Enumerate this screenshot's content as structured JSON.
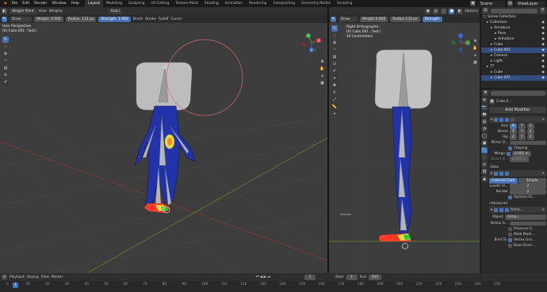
{
  "menubar": {
    "file": "File",
    "edit": "Edit",
    "render": "Render",
    "window": "Window",
    "help": "Help",
    "scene": "Scene",
    "view_layer": "ViewLayer"
  },
  "workspaces": [
    "Layout",
    "Modeling",
    "Sculpting",
    "UV Editing",
    "Texture Paint",
    "Shading",
    "Animation",
    "Rendering",
    "Compositing",
    "Geometry Nodes",
    "Scripting"
  ],
  "left_view": {
    "header": {
      "mode": "Weight Paint",
      "view": "View",
      "weights": "Weights",
      "object": "foot.l",
      "brush": "Draw",
      "weight_label": "Weight",
      "weight_value": "0.000",
      "radius_label": "Radius",
      "radius_value": "133 px",
      "strength_label": "Strength",
      "strength_value": "1.000",
      "brush_menu": "Brush",
      "stroke_menu": "Stroke",
      "falloff_menu": "Falloff",
      "cursor_menu": "Cursor"
    },
    "overlay": {
      "title": "User Perspective",
      "subtitle": "(0) Cube.001 : foot.l"
    },
    "gizmo": {
      "x": "X",
      "y": "Y",
      "z": "Z"
    }
  },
  "right_view": {
    "header": {
      "brush": "Draw",
      "weight_label": "Weight",
      "weight_value": "0.000",
      "radius_label": "Radius",
      "radius_value": "133 px",
      "strength_label": "Strength",
      "options": "Options"
    },
    "overlay": {
      "title": "Right Orthographic",
      "line2": "(0) Cube.001 : foot.l",
      "line3": "10 Centimeters"
    }
  },
  "outliner": {
    "search": "",
    "root": "Scene Collection",
    "items": [
      {
        "label": "Collection",
        "indent": 1,
        "sel": false
      },
      {
        "label": "Armature",
        "indent": 2,
        "sel": false
      },
      {
        "label": "Pose",
        "indent": 3,
        "sel": false
      },
      {
        "label": "Armature",
        "indent": 3,
        "sel": false
      },
      {
        "label": "Cube",
        "indent": 2,
        "sel": false
      },
      {
        "label": "Cube.001",
        "indent": 2,
        "sel": true
      },
      {
        "label": "Camera",
        "indent": 2,
        "sel": false
      },
      {
        "label": "Light",
        "indent": 2,
        "sel": false
      },
      {
        "label": "TT",
        "indent": 1,
        "sel": false
      },
      {
        "label": "Cube",
        "indent": 2,
        "sel": false
      },
      {
        "label": "Cube.001",
        "indent": 2,
        "sel": true
      }
    ]
  },
  "properties": {
    "object_name": "Cube.0...",
    "modifier_name": "Arma...",
    "add_modifier": "Add Modifier",
    "mirror": {
      "name": "Mirror",
      "axis": "Axis",
      "bisect": "Bisect",
      "flip": "Flip",
      "x": "X",
      "y": "Y",
      "z": "Z",
      "mirror_obj": "Mirror O...",
      "clipping": "Clipping",
      "merge": "Merge",
      "merge_value": "0.001 m",
      "bisect_dist": "Bisect D...",
      "bisect_value": "0.001 m"
    },
    "data": "Data",
    "subsurf": {
      "catmull": "Catmull-Clark",
      "simple": "Simple",
      "levels_vi": "Levels Vi...",
      "levels_value": "2",
      "render": "Render",
      "render_value": "2",
      "optimal": "Optimal Di..."
    },
    "advanced": "Advanced",
    "armature": {
      "name": "Arma...",
      "object": "Object",
      "object_value": "Arma...",
      "vertex_group": "Vertex G...",
      "preserve": "Preserve V...",
      "multi": "Multi Modi...",
      "bind_to": "Bind To",
      "vertex_groups": "Vertex Gro...",
      "bone_env": "Bone Enve..."
    }
  },
  "timeline": {
    "playback": "Playback",
    "keying": "Keying",
    "view": "View",
    "marker": "Marker",
    "current": "1",
    "start_label": "Start",
    "start": "1",
    "end_label": "End",
    "end": "250",
    "ticks": [
      "0",
      "10",
      "20",
      "30",
      "40",
      "50",
      "60",
      "70",
      "80",
      "90",
      "100",
      "110",
      "120",
      "130",
      "140",
      "150",
      "160",
      "170",
      "180",
      "190",
      "200",
      "210",
      "220",
      "230",
      "240",
      "250"
    ]
  },
  "colors": {
    "accent": "#4772b3",
    "viewport": "#3d3d3d",
    "header": "#303030",
    "outliner_sel": "#334d80",
    "brush_ring": "#d46a6a"
  }
}
